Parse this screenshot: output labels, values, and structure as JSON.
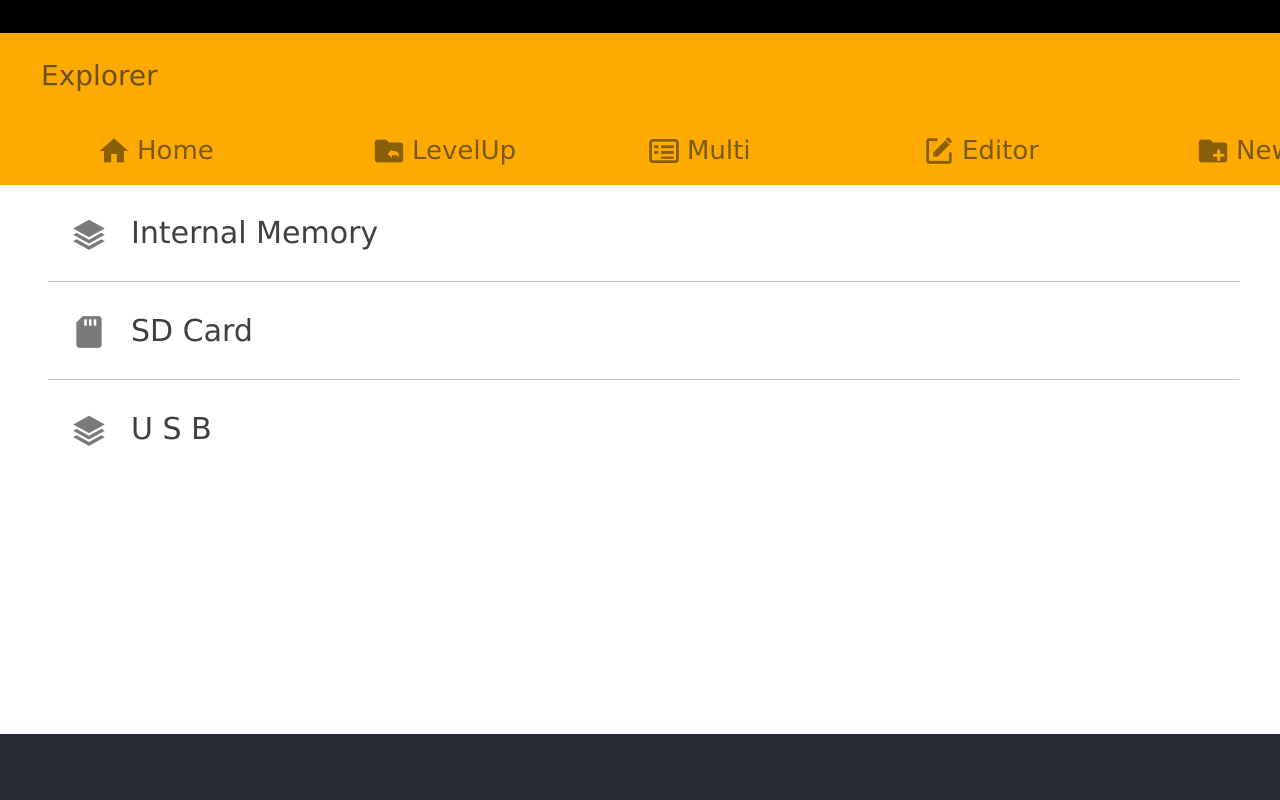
{
  "app": {
    "title": "Explorer"
  },
  "toolbar": {
    "items": [
      {
        "label": "Home",
        "icon": "home-icon"
      },
      {
        "label": "LevelUp",
        "icon": "folder-up-icon"
      },
      {
        "label": "Multi",
        "icon": "multi-select-icon"
      },
      {
        "label": "Editor",
        "icon": "edit-icon"
      },
      {
        "label": "New",
        "icon": "new-folder-icon"
      }
    ]
  },
  "storage": {
    "items": [
      {
        "label": "Internal Memory",
        "icon": "layers-icon"
      },
      {
        "label": "SD Card",
        "icon": "sd-card-icon"
      },
      {
        "label": "U S B",
        "icon": "layers-icon"
      }
    ]
  },
  "colors": {
    "app_bar": "#FFAA00",
    "toolbar_icon": "#8a5f0a",
    "list_icon": "#7a7a7a",
    "nav_bar": "#262a33",
    "status_bar": "#000000"
  }
}
